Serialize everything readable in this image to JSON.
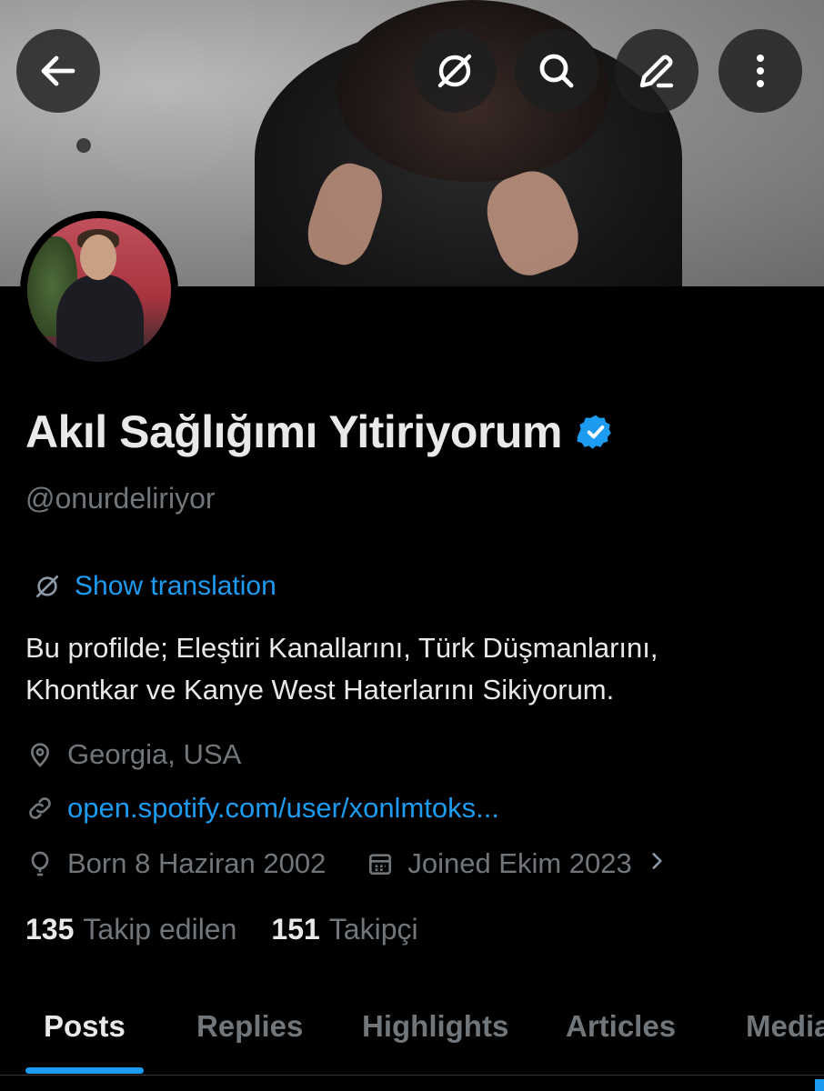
{
  "header": {
    "back_icon": "arrow-left-icon",
    "translate_icon": "translate-globe-icon",
    "search_icon": "search-icon",
    "edit_icon": "pencil-icon",
    "more_icon": "more-vertical-icon"
  },
  "profile": {
    "display_name": "Akıl Sağlığımı Yitiriyorum",
    "verified_icon": "verified-badge-icon",
    "handle": "@onurdeliriyor",
    "show_translation": "Show translation",
    "bio_lines": [
      "Bu profilde; Eleştiri Kanallarını, Türk Düşmanlarını,",
      "Khontkar ve Kanye West Haterlarını Sikiyorum."
    ],
    "location": "Georgia, USA",
    "url": "open.spotify.com/user/xonlmtoks...",
    "born": "Born 8 Haziran 2002",
    "joined": "Joined Ekim 2023"
  },
  "stats": {
    "following_count": "135",
    "following_label": "Takip edilen",
    "followers_count": "151",
    "followers_label": "Takipçi"
  },
  "tabs": [
    {
      "label": "Posts",
      "active": true
    },
    {
      "label": "Replies",
      "active": false
    },
    {
      "label": "Highlights",
      "active": false
    },
    {
      "label": "Articles",
      "active": false
    },
    {
      "label": "Media",
      "active": false
    }
  ],
  "colors": {
    "accent": "#1d9bf0",
    "background": "#000000",
    "text_primary": "#e7e9ea",
    "text_secondary": "#71767b"
  }
}
